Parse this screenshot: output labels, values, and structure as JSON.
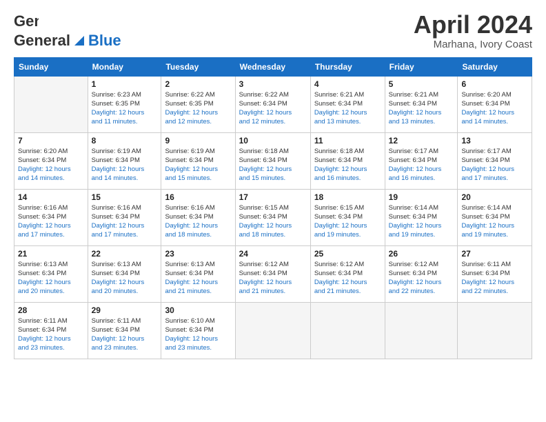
{
  "logo": {
    "general": "General",
    "blue": "Blue"
  },
  "title": "April 2024",
  "subtitle": "Marhana, Ivory Coast",
  "days_header": [
    "Sunday",
    "Monday",
    "Tuesday",
    "Wednesday",
    "Thursday",
    "Friday",
    "Saturday"
  ],
  "weeks": [
    [
      {
        "day": "",
        "sunrise": "",
        "sunset": "",
        "daylight": ""
      },
      {
        "day": "1",
        "sunrise": "Sunrise: 6:23 AM",
        "sunset": "Sunset: 6:35 PM",
        "daylight": "Daylight: 12 hours and 11 minutes."
      },
      {
        "day": "2",
        "sunrise": "Sunrise: 6:22 AM",
        "sunset": "Sunset: 6:35 PM",
        "daylight": "Daylight: 12 hours and 12 minutes."
      },
      {
        "day": "3",
        "sunrise": "Sunrise: 6:22 AM",
        "sunset": "Sunset: 6:34 PM",
        "daylight": "Daylight: 12 hours and 12 minutes."
      },
      {
        "day": "4",
        "sunrise": "Sunrise: 6:21 AM",
        "sunset": "Sunset: 6:34 PM",
        "daylight": "Daylight: 12 hours and 13 minutes."
      },
      {
        "day": "5",
        "sunrise": "Sunrise: 6:21 AM",
        "sunset": "Sunset: 6:34 PM",
        "daylight": "Daylight: 12 hours and 13 minutes."
      },
      {
        "day": "6",
        "sunrise": "Sunrise: 6:20 AM",
        "sunset": "Sunset: 6:34 PM",
        "daylight": "Daylight: 12 hours and 14 minutes."
      }
    ],
    [
      {
        "day": "7",
        "sunrise": "Sunrise: 6:20 AM",
        "sunset": "Sunset: 6:34 PM",
        "daylight": "Daylight: 12 hours and 14 minutes."
      },
      {
        "day": "8",
        "sunrise": "Sunrise: 6:19 AM",
        "sunset": "Sunset: 6:34 PM",
        "daylight": "Daylight: 12 hours and 14 minutes."
      },
      {
        "day": "9",
        "sunrise": "Sunrise: 6:19 AM",
        "sunset": "Sunset: 6:34 PM",
        "daylight": "Daylight: 12 hours and 15 minutes."
      },
      {
        "day": "10",
        "sunrise": "Sunrise: 6:18 AM",
        "sunset": "Sunset: 6:34 PM",
        "daylight": "Daylight: 12 hours and 15 minutes."
      },
      {
        "day": "11",
        "sunrise": "Sunrise: 6:18 AM",
        "sunset": "Sunset: 6:34 PM",
        "daylight": "Daylight: 12 hours and 16 minutes."
      },
      {
        "day": "12",
        "sunrise": "Sunrise: 6:17 AM",
        "sunset": "Sunset: 6:34 PM",
        "daylight": "Daylight: 12 hours and 16 minutes."
      },
      {
        "day": "13",
        "sunrise": "Sunrise: 6:17 AM",
        "sunset": "Sunset: 6:34 PM",
        "daylight": "Daylight: 12 hours and 17 minutes."
      }
    ],
    [
      {
        "day": "14",
        "sunrise": "Sunrise: 6:16 AM",
        "sunset": "Sunset: 6:34 PM",
        "daylight": "Daylight: 12 hours and 17 minutes."
      },
      {
        "day": "15",
        "sunrise": "Sunrise: 6:16 AM",
        "sunset": "Sunset: 6:34 PM",
        "daylight": "Daylight: 12 hours and 17 minutes."
      },
      {
        "day": "16",
        "sunrise": "Sunrise: 6:16 AM",
        "sunset": "Sunset: 6:34 PM",
        "daylight": "Daylight: 12 hours and 18 minutes."
      },
      {
        "day": "17",
        "sunrise": "Sunrise: 6:15 AM",
        "sunset": "Sunset: 6:34 PM",
        "daylight": "Daylight: 12 hours and 18 minutes."
      },
      {
        "day": "18",
        "sunrise": "Sunrise: 6:15 AM",
        "sunset": "Sunset: 6:34 PM",
        "daylight": "Daylight: 12 hours and 19 minutes."
      },
      {
        "day": "19",
        "sunrise": "Sunrise: 6:14 AM",
        "sunset": "Sunset: 6:34 PM",
        "daylight": "Daylight: 12 hours and 19 minutes."
      },
      {
        "day": "20",
        "sunrise": "Sunrise: 6:14 AM",
        "sunset": "Sunset: 6:34 PM",
        "daylight": "Daylight: 12 hours and 19 minutes."
      }
    ],
    [
      {
        "day": "21",
        "sunrise": "Sunrise: 6:13 AM",
        "sunset": "Sunset: 6:34 PM",
        "daylight": "Daylight: 12 hours and 20 minutes."
      },
      {
        "day": "22",
        "sunrise": "Sunrise: 6:13 AM",
        "sunset": "Sunset: 6:34 PM",
        "daylight": "Daylight: 12 hours and 20 minutes."
      },
      {
        "day": "23",
        "sunrise": "Sunrise: 6:13 AM",
        "sunset": "Sunset: 6:34 PM",
        "daylight": "Daylight: 12 hours and 21 minutes."
      },
      {
        "day": "24",
        "sunrise": "Sunrise: 6:12 AM",
        "sunset": "Sunset: 6:34 PM",
        "daylight": "Daylight: 12 hours and 21 minutes."
      },
      {
        "day": "25",
        "sunrise": "Sunrise: 6:12 AM",
        "sunset": "Sunset: 6:34 PM",
        "daylight": "Daylight: 12 hours and 21 minutes."
      },
      {
        "day": "26",
        "sunrise": "Sunrise: 6:12 AM",
        "sunset": "Sunset: 6:34 PM",
        "daylight": "Daylight: 12 hours and 22 minutes."
      },
      {
        "day": "27",
        "sunrise": "Sunrise: 6:11 AM",
        "sunset": "Sunset: 6:34 PM",
        "daylight": "Daylight: 12 hours and 22 minutes."
      }
    ],
    [
      {
        "day": "28",
        "sunrise": "Sunrise: 6:11 AM",
        "sunset": "Sunset: 6:34 PM",
        "daylight": "Daylight: 12 hours and 23 minutes."
      },
      {
        "day": "29",
        "sunrise": "Sunrise: 6:11 AM",
        "sunset": "Sunset: 6:34 PM",
        "daylight": "Daylight: 12 hours and 23 minutes."
      },
      {
        "day": "30",
        "sunrise": "Sunrise: 6:10 AM",
        "sunset": "Sunset: 6:34 PM",
        "daylight": "Daylight: 12 hours and 23 minutes."
      },
      {
        "day": "",
        "sunrise": "",
        "sunset": "",
        "daylight": ""
      },
      {
        "day": "",
        "sunrise": "",
        "sunset": "",
        "daylight": ""
      },
      {
        "day": "",
        "sunrise": "",
        "sunset": "",
        "daylight": ""
      },
      {
        "day": "",
        "sunrise": "",
        "sunset": "",
        "daylight": ""
      }
    ]
  ]
}
